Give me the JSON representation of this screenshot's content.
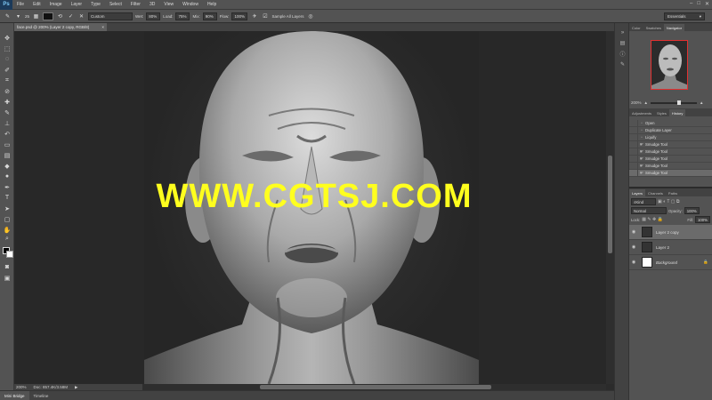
{
  "app": {
    "logo": "Ps"
  },
  "menu": [
    "File",
    "Edit",
    "Image",
    "Layer",
    "Type",
    "Select",
    "Filter",
    "3D",
    "View",
    "Window",
    "Help"
  ],
  "window_controls": [
    "–",
    "□",
    "✕"
  ],
  "options": {
    "brush_size": "25",
    "preset": "Custom",
    "wet_label": "Wet:",
    "wet_value": "80%",
    "load_label": "Load:",
    "load_value": "75%",
    "mix_label": "Mix:",
    "mix_value": "90%",
    "flow_label": "Flow:",
    "flow_value": "100%",
    "sample_all_layers": "Sample All Layers",
    "workspace": "Essentials"
  },
  "document": {
    "tab_title": "face.psd @ 200% (Layer 2 copy, RGB/8)",
    "zoom": "200%",
    "doc_size": "Doc: 857.4K/3.58M"
  },
  "bottom_tabs": [
    "Mini Bridge",
    "Timeline"
  ],
  "watermark": "WWW.CGTSJ.COM",
  "panels": {
    "top_tabs": [
      "Color",
      "Swatches",
      "Navigator"
    ],
    "navigator_zoom": "200%",
    "mid_tabs": [
      "Adjustments",
      "Styles",
      "History"
    ],
    "history": [
      "Open",
      "Duplicate Layer",
      "Liquify",
      "Smudge Tool",
      "Smudge Tool",
      "Smudge Tool",
      "Smudge Tool",
      "Smudge Tool"
    ],
    "layer_tabs": [
      "Layers",
      "Channels",
      "Paths"
    ],
    "layer_kind": "Kind",
    "blend_mode": "Normal",
    "opacity_label": "Opacity:",
    "opacity_value": "100%",
    "lock_label": "Lock:",
    "fill_label": "Fill:",
    "fill_value": "100%",
    "layers": [
      "Layer 2 copy",
      "Layer 2",
      "Background"
    ]
  },
  "colors": {
    "watermark": "#ffff1e",
    "nav_frame": "#e23030"
  }
}
